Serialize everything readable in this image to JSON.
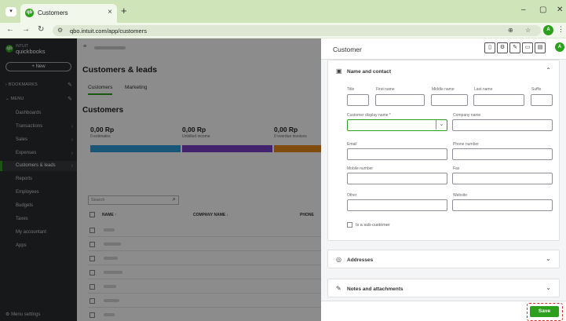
{
  "browser": {
    "tab_title": "Customers",
    "url": "qbo.intuit.com/app/customers",
    "profile_initial": "A"
  },
  "sidebar": {
    "logo_top": "INTUIT",
    "logo_bottom": "quickbooks",
    "new_label": "+ New",
    "bookmarks_label": "BOOKMARKS",
    "menu_label": "MENU",
    "items": [
      {
        "label": "Dashboards"
      },
      {
        "label": "Transactions"
      },
      {
        "label": "Sales"
      },
      {
        "label": "Expenses"
      },
      {
        "label": "Customers & leads"
      },
      {
        "label": "Reports"
      },
      {
        "label": "Employees"
      },
      {
        "label": "Budgets"
      },
      {
        "label": "Taxes"
      },
      {
        "label": "My accountant"
      },
      {
        "label": "Apps"
      }
    ],
    "menu_settings": "Menu settings"
  },
  "main": {
    "page_title": "Customers & leads",
    "tabs": [
      "Customers",
      "Marketing"
    ],
    "section_title": "Customers",
    "stats": [
      {
        "value": "0,00 Rp",
        "label": "0 estimates"
      },
      {
        "value": "0,00 Rp",
        "label": "Unbilled income"
      },
      {
        "value": "0,00 Rp",
        "label": "0 overdue invoices"
      }
    ],
    "bar_colors": [
      "#2d9fd9",
      "#7b3fc9",
      "#e88a1a"
    ],
    "search_placeholder": "Search",
    "columns": [
      "NAME ↑",
      "COMPANY NAME ↓",
      "PHONE"
    ]
  },
  "drawer": {
    "title": "Customer",
    "header_icons": [
      "page-icon",
      "gear-icon",
      "edit-icon",
      "card-icon",
      "doc-icon"
    ],
    "name_section": {
      "title": "Name and contact",
      "fields": {
        "title": "Title",
        "first_name": "First name",
        "middle_name": "Middle name",
        "last_name": "Last name",
        "suffix": "Suffix",
        "display_name": "Customer display name *",
        "company_name": "Company name",
        "email": "Email",
        "phone": "Phone number",
        "mobile": "Mobile number",
        "fax": "Fax",
        "other": "Other",
        "website": "Website"
      },
      "sub_customer_label": "Is a sub-customer"
    },
    "addresses_title": "Addresses",
    "notes_title": "Notes and attachments",
    "save_label": "Save"
  }
}
